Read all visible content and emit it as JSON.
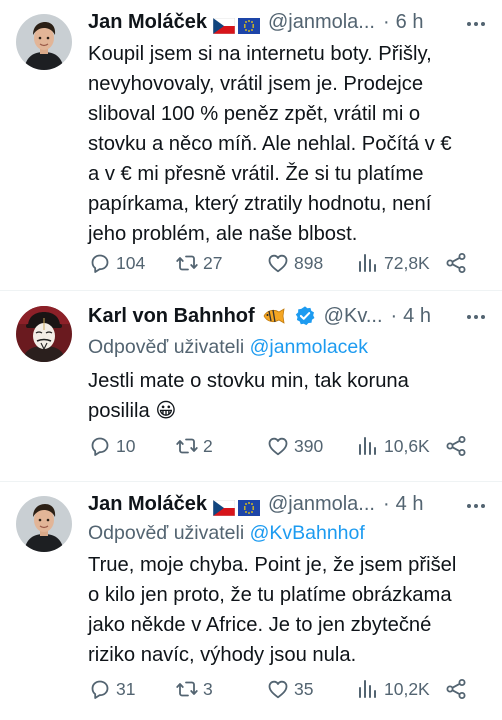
{
  "tweets": [
    {
      "name": "Jan Moláček",
      "handle": "@janmola...",
      "dot": "·",
      "time": "6 h",
      "reply_prefix": "",
      "reply_mention": "",
      "lines": [
        "Koupil jsem si na internetu boty. Přišly,",
        "nevyhovovaly, vrátil jsem je. Prodejce",
        "sliboval 100 % peněz zpět, vrátil mi o",
        "stovku a něco míň. Ale nehlal. Počítá v €",
        "a v € mi přesně vrátil. Že si tu platíme",
        "papírkama, který ztratily hodnotu, není",
        "jeho problém, ale naše blbost."
      ],
      "stats": {
        "replies": "104",
        "retweets": "27",
        "likes": "898",
        "views": "72,8K"
      }
    },
    {
      "name": "Karl von Bahnhof",
      "handle": "@Kv...",
      "dot": "·",
      "time": "4 h",
      "reply_prefix": "Odpověď uživateli",
      "reply_mention": "@janmolacek",
      "lines": [
        "Jestli mate o stovku min, tak koruna",
        "posilila 😀"
      ],
      "stats": {
        "replies": "10",
        "retweets": "2",
        "likes": "390",
        "views": "10,6K"
      }
    },
    {
      "name": "Jan Moláček",
      "handle": "@janmola...",
      "dot": "·",
      "time": "4 h",
      "reply_prefix": "Odpověď uživateli",
      "reply_mention": "@KvBahnhof",
      "lines": [
        "True, moje chyba. Point je, že jsem přišel",
        "o kilo jen proto, že tu platíme obrázkama",
        "jako někde v Africe. Je to jen zbytečné",
        "riziko navíc, výhody jsou nula."
      ],
      "stats": {
        "replies": "31",
        "retweets": "3",
        "likes": "35",
        "views": "10,2K"
      }
    }
  ],
  "icons": {
    "flag_cz": "czech-flag-icon",
    "flag_eu": "eu-flag-icon",
    "fish": "fish-emoji-icon",
    "verified": "verified-badge-icon",
    "more": "more-dots-icon",
    "reply": "reply-icon",
    "retweet": "retweet-icon",
    "like": "heart-icon",
    "views": "views-chart-icon",
    "share": "share-icon"
  },
  "colors": {
    "text": "#0f1419",
    "secondary": "#536471",
    "link": "#1d9bf0",
    "divider": "#eff3f4"
  }
}
